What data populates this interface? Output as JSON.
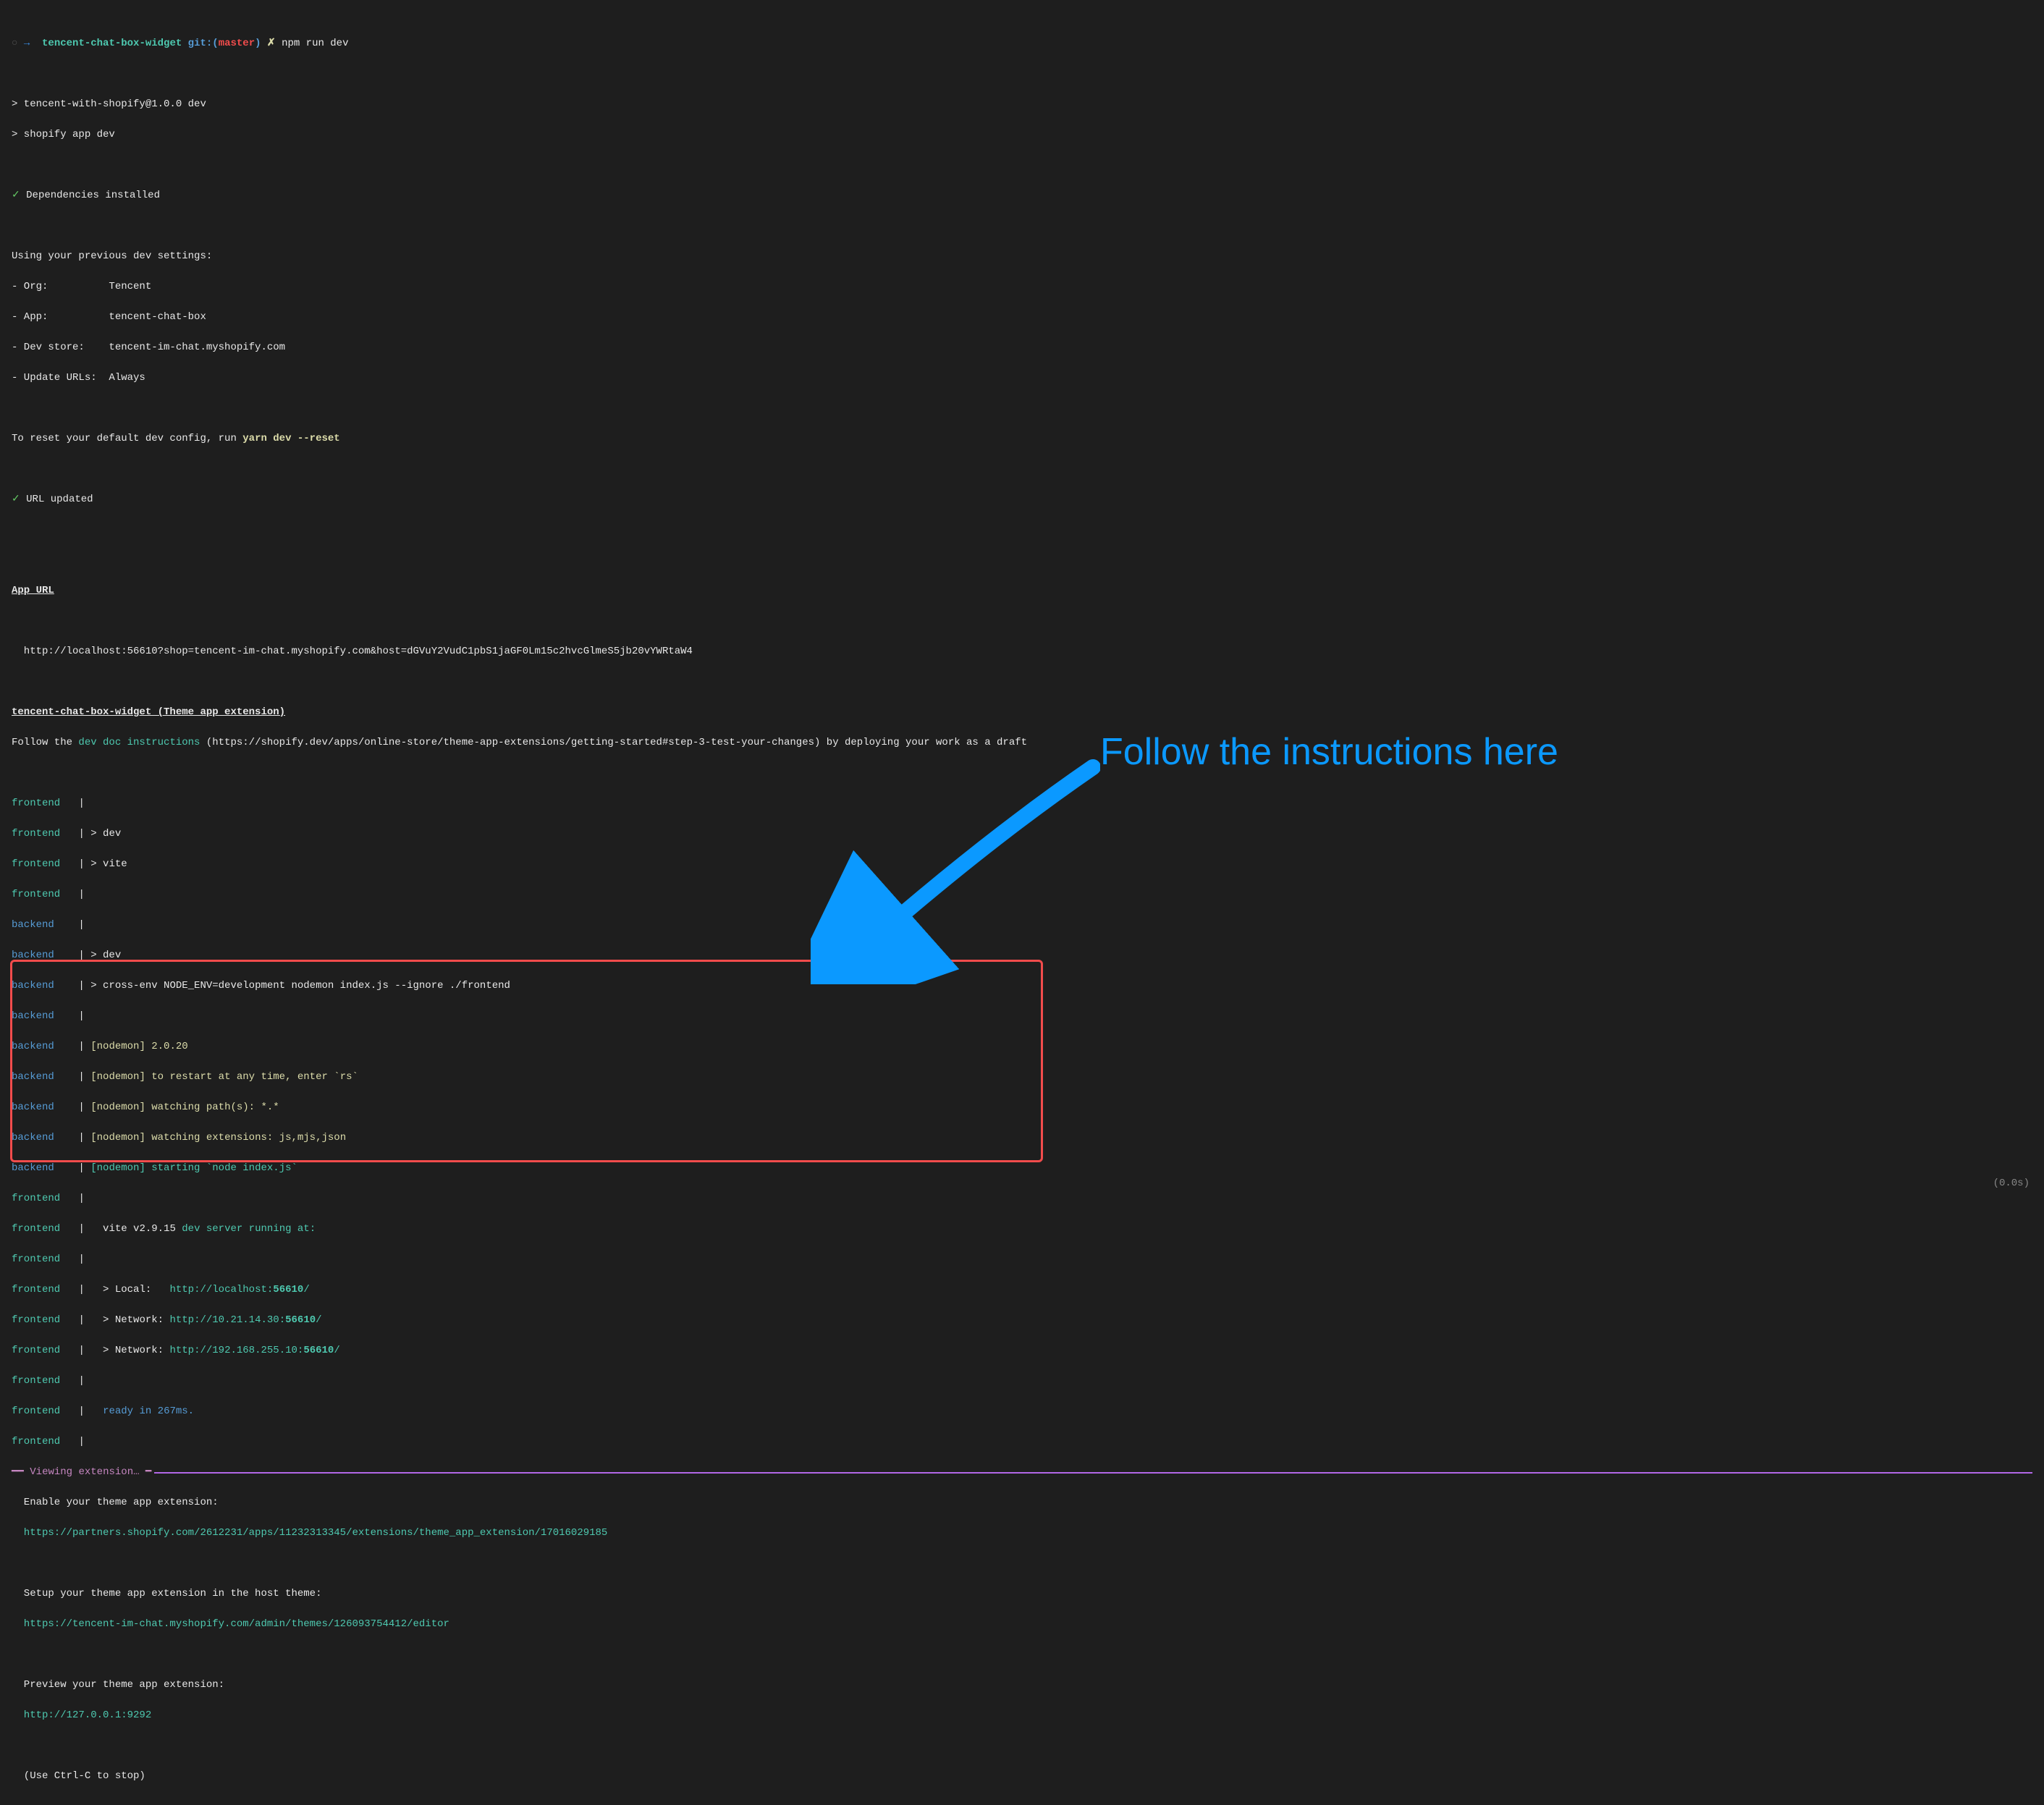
{
  "prompt": {
    "circle": "○",
    "arrow": "→",
    "dir": "tencent-chat-box-widget",
    "git": "git:(",
    "branch": "master",
    "gitClose": ")",
    "x": "✗",
    "cmd": "npm run dev"
  },
  "npm": {
    "line1": "> tencent-with-shopify@1.0.0 dev",
    "line2": "> shopify app dev"
  },
  "deps": {
    "check": "✓",
    "text": "Dependencies installed"
  },
  "settings": {
    "header": "Using your previous dev settings:",
    "org": "- Org:          Tencent",
    "app": "- App:          tencent-chat-box",
    "store": "- Dev store:    tencent-im-chat.myshopify.com",
    "update": "- Update URLs:  Always"
  },
  "reset": {
    "pre": "To reset your default dev config, run ",
    "cmd": "yarn dev --reset"
  },
  "urlUpdated": {
    "check": "✓",
    "text": "URL updated"
  },
  "appUrl": {
    "title": "App URL",
    "url": "  http://localhost:56610?shop=tencent-im-chat.myshopify.com&host=dGVuY2VudC1pbS1jaGF0Lm15c2hvcGlmeS5jb20vYWRtaW4"
  },
  "themeExt": {
    "title": "tencent-chat-box-widget (Theme app extension)",
    "follow1": "Follow the ",
    "link": "dev doc instructions",
    "follow2": " (https://shopify.dev/apps/online-store/theme-app-extensions/getting-started#step-3-test-your-changes) by deploying your work as a draft"
  },
  "logs": [
    {
      "tag": "frontend",
      "pipe": "|",
      "rest": ""
    },
    {
      "tag": "frontend",
      "pipe": "|",
      "rest": " > dev"
    },
    {
      "tag": "frontend",
      "pipe": "|",
      "rest": " > vite"
    },
    {
      "tag": "frontend",
      "pipe": "|",
      "rest": ""
    },
    {
      "tag": "backend",
      "pipe": "|",
      "rest": ""
    },
    {
      "tag": "backend",
      "pipe": "|",
      "rest": " > dev"
    },
    {
      "tag": "backend",
      "pipe": "|",
      "rest": " > cross-env NODE_ENV=development nodemon index.js --ignore ./frontend"
    },
    {
      "tag": "backend",
      "pipe": "|",
      "rest": ""
    }
  ],
  "nodemon": [
    {
      "tag": "backend",
      "pipe": "|",
      "pre": " ",
      "mon": "[nodemon] 2.0.20"
    },
    {
      "tag": "backend",
      "pipe": "|",
      "pre": " ",
      "mon": "[nodemon] to restart at any time, enter `rs`"
    },
    {
      "tag": "backend",
      "pipe": "|",
      "pre": " ",
      "mon": "[nodemon] watching path(s): *.*"
    },
    {
      "tag": "backend",
      "pipe": "|",
      "pre": " ",
      "mon": "[nodemon] watching extensions: js,mjs,json"
    },
    {
      "tag": "backend",
      "pipe": "|",
      "pre": " ",
      "mon": "[nodemon] starting `node index.js`"
    }
  ],
  "vite": {
    "fe": "frontend",
    "pipe": "|",
    "pre": "   vite v2.9.15 ",
    "running": "dev server running at:",
    "localLabel": "   > Local:   ",
    "localUrl": "http://localhost:",
    "localPort": "56610",
    "localSlash": "/",
    "net1Label": "   > Network: ",
    "net1Url": "http://10.21.14.30:",
    "net1Port": "56610",
    "net1Slash": "/",
    "net2Label": "   > Network: ",
    "net2Url": "http://192.168.255.10:",
    "net2Port": "56610",
    "net2Slash": "/",
    "readyPre": "   ",
    "ready": "ready in 267ms."
  },
  "viewing": {
    "ruleL": "━━ ",
    "title": "Viewing extension…",
    "ruleR": " ━",
    "enable": "  Enable your theme app extension:",
    "enableUrl": "  https://partners.shopify.com/2612231/apps/11232313345/extensions/theme_app_extension/17016029185",
    "setup": "  Setup your theme app extension in the host theme:",
    "setupUrl": "  https://tencent-im-chat.myshopify.com/admin/themes/126093754412/editor",
    "preview": "  Preview your theme app extension:",
    "previewUrl": "  http://127.0.0.1:9292",
    "stop": "  (Use Ctrl-C to stop)"
  },
  "annotation": {
    "text": "Follow the instructions here"
  },
  "timer": "(0.0s)"
}
